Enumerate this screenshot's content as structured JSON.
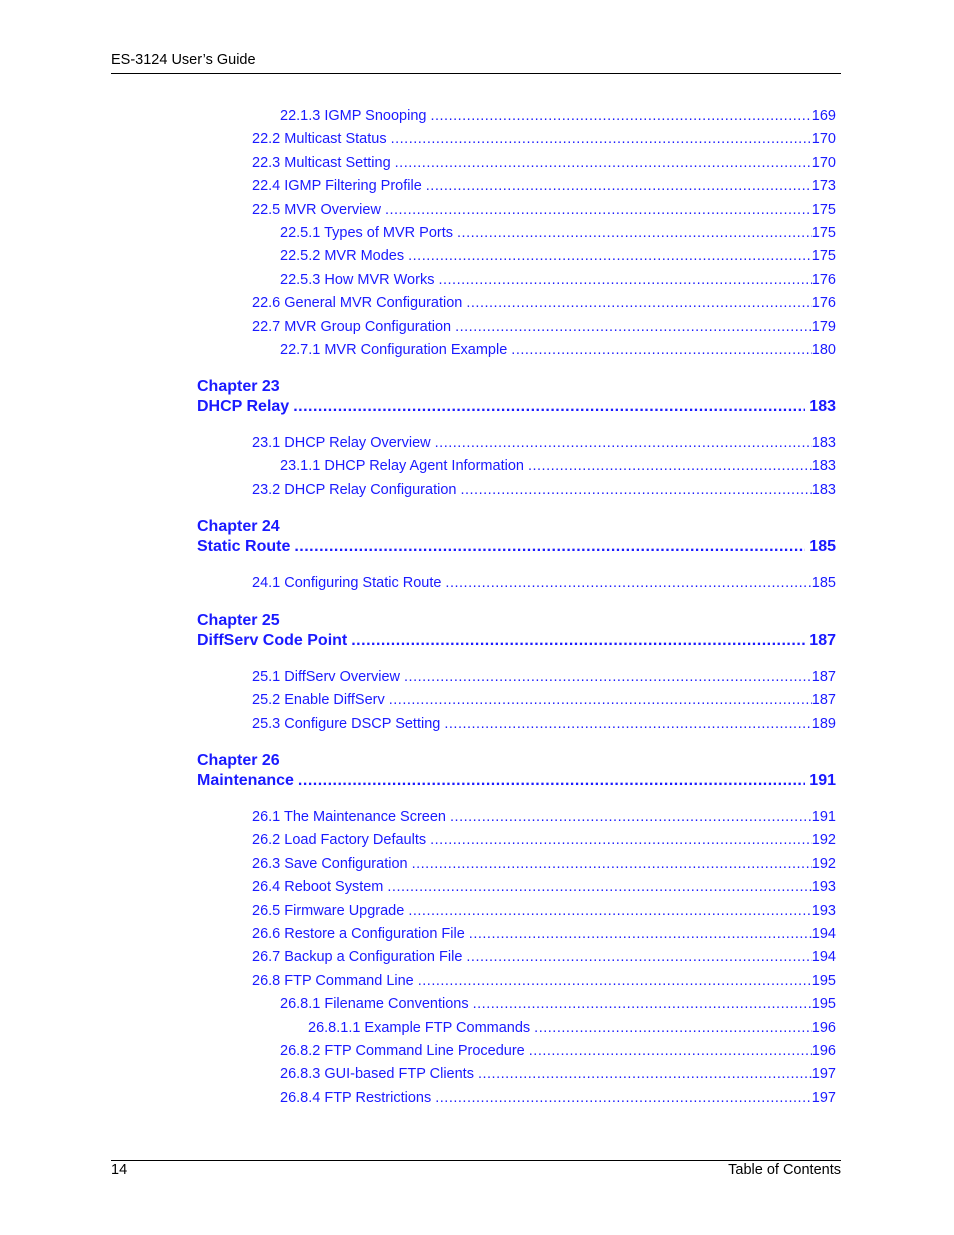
{
  "header": {
    "title": "ES-3124 User’s Guide"
  },
  "footer": {
    "page_number": "14",
    "section": "Table of Contents"
  },
  "toc": {
    "pre_entries": [
      {
        "label": "22.1.3 IGMP Snooping",
        "page": "169",
        "level": 3
      },
      {
        "label": "22.2 Multicast Status",
        "page": "170",
        "level": 2
      },
      {
        "label": "22.3 Multicast Setting",
        "page": "170",
        "level": 2
      },
      {
        "label": "22.4 IGMP Filtering Profile",
        "page": "173",
        "level": 2
      },
      {
        "label": "22.5 MVR Overview",
        "page": "175",
        "level": 2
      },
      {
        "label": "22.5.1 Types of MVR Ports",
        "page": "175",
        "level": 3
      },
      {
        "label": "22.5.2 MVR Modes",
        "page": "175",
        "level": 3
      },
      {
        "label": "22.5.3 How MVR Works",
        "page": "176",
        "level": 3
      },
      {
        "label": "22.6 General MVR Configuration",
        "page": "176",
        "level": 2
      },
      {
        "label": "22.7 MVR Group Configuration",
        "page": "179",
        "level": 2
      },
      {
        "label": "22.7.1 MVR Configuration Example",
        "page": "180",
        "level": 3
      }
    ],
    "chapters": [
      {
        "number": "Chapter 23",
        "title": "DHCP Relay",
        "page": "183",
        "entries": [
          {
            "label": "23.1 DHCP Relay Overview",
            "page": "183",
            "level": 2
          },
          {
            "label": "23.1.1 DHCP Relay Agent Information",
            "page": "183",
            "level": 3
          },
          {
            "label": "23.2 DHCP Relay Configuration",
            "page": "183",
            "level": 2
          }
        ]
      },
      {
        "number": "Chapter 24",
        "title": "Static Route",
        "page": "185",
        "entries": [
          {
            "label": "24.1 Configuring Static Route",
            "page": "185",
            "level": 2
          }
        ]
      },
      {
        "number": "Chapter 25",
        "title": "DiffServ Code Point",
        "page": "187",
        "entries": [
          {
            "label": "25.1  DiffServ Overview",
            "page": "187",
            "level": 2
          },
          {
            "label": "25.2 Enable DiffServ",
            "page": "187",
            "level": 2
          },
          {
            "label": "25.3 Configure DSCP Setting",
            "page": "189",
            "level": 2
          }
        ]
      },
      {
        "number": "Chapter 26",
        "title": "Maintenance",
        "page": "191",
        "entries": [
          {
            "label": "26.1 The Maintenance Screen",
            "page": "191",
            "level": 2
          },
          {
            "label": "26.2 Load Factory Defaults",
            "page": "192",
            "level": 2
          },
          {
            "label": "26.3 Save Configuration",
            "page": "192",
            "level": 2
          },
          {
            "label": "26.4 Reboot System",
            "page": "193",
            "level": 2
          },
          {
            "label": "26.5 Firmware Upgrade",
            "page": "193",
            "level": 2
          },
          {
            "label": "26.6 Restore a Configuration File",
            "page": "194",
            "level": 2
          },
          {
            "label": "26.7 Backup a Configuration File",
            "page": "194",
            "level": 2
          },
          {
            "label": "26.8 FTP Command Line",
            "page": "195",
            "level": 2
          },
          {
            "label": "26.8.1 Filename Conventions",
            "page": "195",
            "level": 3
          },
          {
            "label": "26.8.1.1 Example FTP Commands",
            "page": "196",
            "level": 4
          },
          {
            "label": "26.8.2 FTP Command Line Procedure",
            "page": "196",
            "level": 3
          },
          {
            "label": "26.8.3 GUI-based FTP Clients",
            "page": "197",
            "level": 3
          },
          {
            "label": "26.8.4 FTP Restrictions",
            "page": "197",
            "level": 3
          }
        ]
      }
    ]
  }
}
